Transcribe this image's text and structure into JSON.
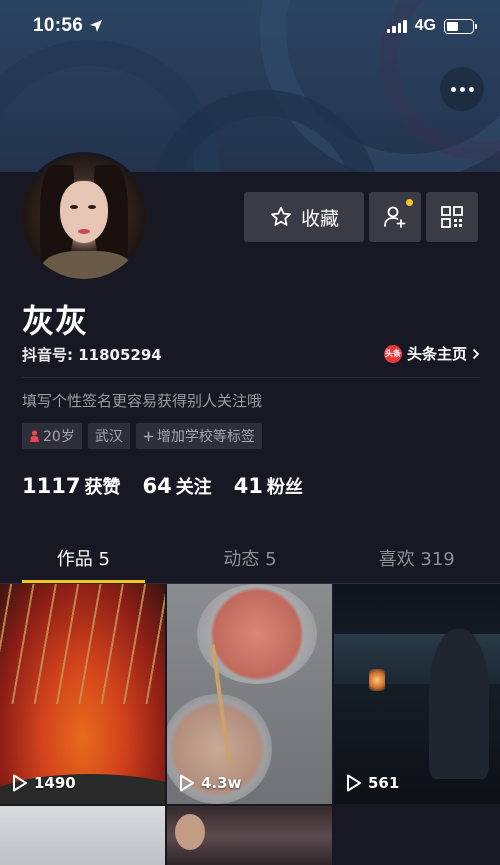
{
  "status_bar": {
    "time": "10:56",
    "network": "4G"
  },
  "profile": {
    "name": "灰灰",
    "douyin_id": "抖音号: 11805294",
    "toutiao_label": "头条主页",
    "toutiao_logo_text": "头条",
    "signature": "填写个性签名更容易获得别人关注哦",
    "favorite_label": "收藏",
    "tags": {
      "age": "20岁",
      "city": "武汉",
      "add_school": "增加学校等标签"
    }
  },
  "stats": {
    "likes": {
      "value": "1117",
      "label": "获赞"
    },
    "following": {
      "value": "64",
      "label": "关注"
    },
    "fans": {
      "value": "41",
      "label": "粉丝"
    }
  },
  "tabs": [
    {
      "label": "作品 5",
      "active": true
    },
    {
      "label": "动态 5",
      "active": false
    },
    {
      "label": "喜欢 319",
      "active": false
    }
  ],
  "videos": [
    {
      "plays": "1490"
    },
    {
      "plays": "4.3w"
    },
    {
      "plays": "561"
    }
  ],
  "colors": {
    "background": "#171823",
    "accent_yellow": "#f7c51d",
    "button_bg": "#3a3b45",
    "toutiao_red": "#e8373d"
  },
  "icons": [
    "location-arrow-icon",
    "signal-icon",
    "battery-icon",
    "more-dots-icon",
    "star-icon",
    "add-friend-icon",
    "qr-code-icon",
    "chevron-right-icon",
    "gender-female-icon",
    "plus-icon",
    "play-icon"
  ]
}
